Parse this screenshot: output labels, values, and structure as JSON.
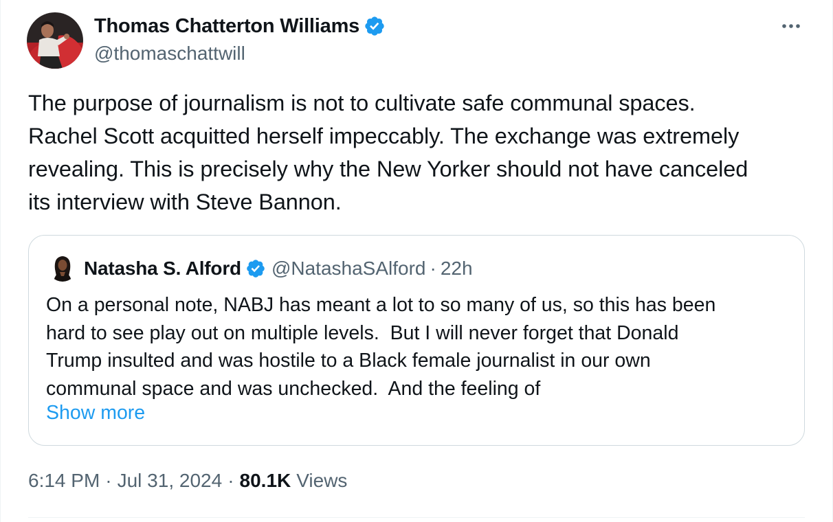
{
  "author": {
    "name": "Thomas Chatterton Williams",
    "handle": "@thomaschattwill",
    "verified": true
  },
  "tweet": {
    "text_lines": [
      "The purpose of journalism is not to cultivate safe communal spaces.",
      "Rachel Scott acquitted herself impeccably. The exchange was extremely",
      "revealing. This is precisely why the New Yorker should not have canceled",
      "its interview with Steve Bannon."
    ]
  },
  "quoted_tweet": {
    "name": "Natasha S. Alford",
    "handle": "@NatashaSAlford",
    "separator": "·",
    "time": "22h",
    "verified": true,
    "text_lines": [
      "On a personal note, NABJ has meant a lot to so many of us, so this has been",
      "hard to see play out on multiple levels.  But I will never forget that Donald",
      "Trump insulted and was hostile to a Black female journalist in our own",
      "communal space and was unchecked.  And the feeling of"
    ],
    "show_more_label": "Show more"
  },
  "meta": {
    "time": "6:14 PM",
    "separator": "·",
    "date": "Jul 31, 2024",
    "views_count": "80.1K",
    "views_label": "Views"
  },
  "colors": {
    "text": "#0f1419",
    "secondary": "#536471",
    "accent": "#1d9bf0",
    "border": "#cfd9de"
  },
  "icons": {
    "verified": "verified-badge-icon",
    "more": "more-horizontal-icon"
  }
}
